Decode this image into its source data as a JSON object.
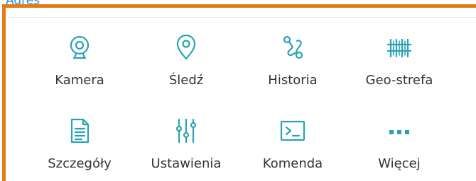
{
  "header": {
    "link_text": "Adres"
  },
  "accent_color": "#e57a17",
  "icon_color": "#2aa2b3",
  "menu": {
    "items": [
      {
        "label": "Kamera",
        "icon": "camera-icon"
      },
      {
        "label": "Śledź",
        "icon": "location-pin-icon"
      },
      {
        "label": "Historia",
        "icon": "route-icon"
      },
      {
        "label": "Geo-strefa",
        "icon": "fence-icon"
      },
      {
        "label": "Szczegóły",
        "icon": "document-icon"
      },
      {
        "label": "Ustawienia",
        "icon": "sliders-icon"
      },
      {
        "label": "Komenda",
        "icon": "terminal-icon"
      },
      {
        "label": "Więcej",
        "icon": "more-icon"
      }
    ]
  }
}
